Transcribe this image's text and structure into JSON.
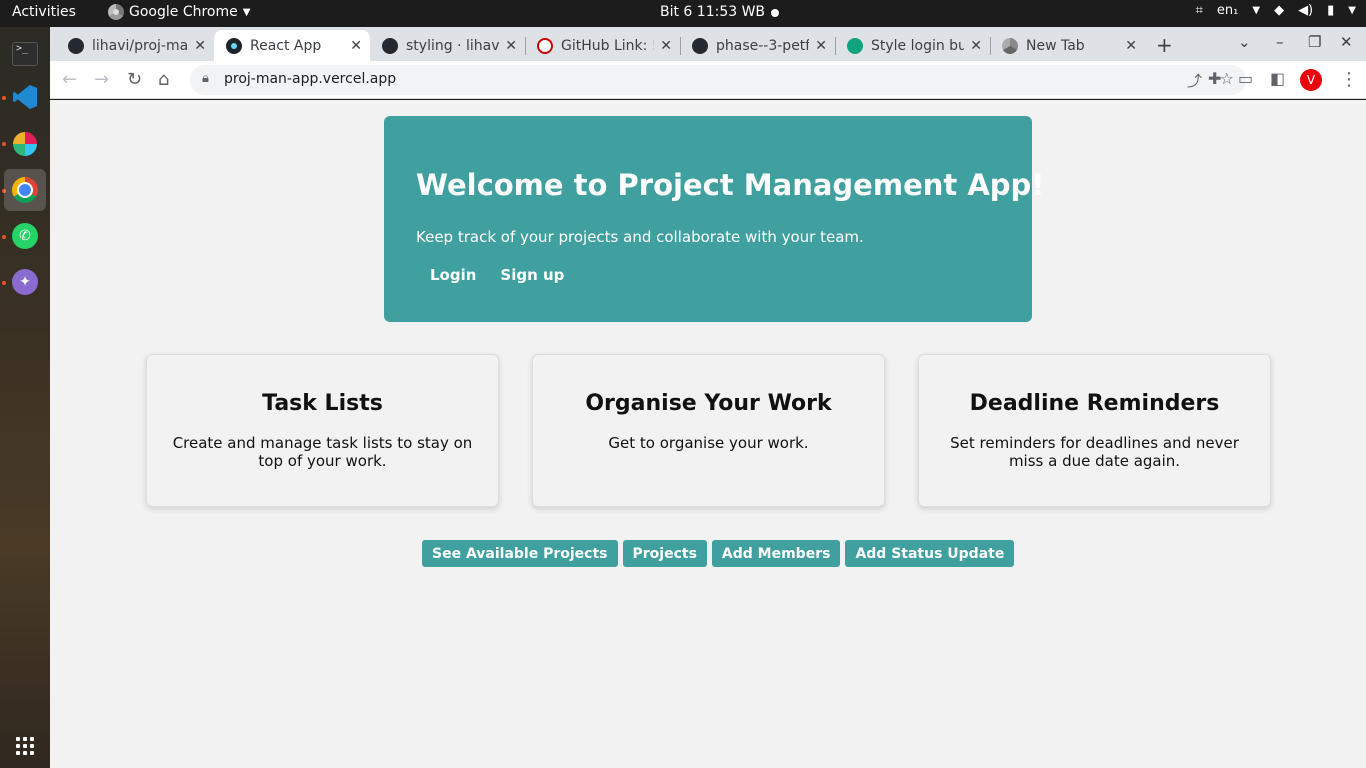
{
  "system_bar": {
    "activities": "Activities",
    "app_name": "Google Chrome",
    "clock": "Bit 6  11:53 WB",
    "language": "en₁"
  },
  "dock": {
    "items": [
      "terminal-icon",
      "vscode-icon",
      "slack-icon",
      "chrome-icon",
      "whatsapp-icon",
      "network-app-icon"
    ]
  },
  "tabs": [
    {
      "title": "lihavi/proj-ma",
      "favicon": "github-icon"
    },
    {
      "title": "React App",
      "favicon": "react-icon",
      "active": true
    },
    {
      "title": "styling · lihav",
      "favicon": "github-icon"
    },
    {
      "title": "GitHub Link: !",
      "favicon": "redhat-icon"
    },
    {
      "title": "phase--3-petf",
      "favicon": "github-icon"
    },
    {
      "title": "Style login bu",
      "favicon": "openai-icon"
    },
    {
      "title": "New Tab",
      "favicon": "chrome-icon"
    }
  ],
  "toolbar": {
    "url": "proj-man-app.vercel.app",
    "profile_initial": "V"
  },
  "hero": {
    "title": "Welcome to Project Management App!",
    "subtitle": "Keep track of your projects and collaborate with your team.",
    "login": "Login",
    "signup": "Sign up"
  },
  "features": [
    {
      "title": "Task Lists",
      "text": "Create and manage task lists to stay on top of your work."
    },
    {
      "title": "Organise Your Work",
      "text": "Get to organise your work."
    },
    {
      "title": "Deadline Reminders",
      "text": "Set reminders for deadlines and never miss a due date again."
    }
  ],
  "actions": {
    "available_projects": "See Available Projects",
    "projects": "Projects",
    "add_members": "Add Members",
    "add_status": "Add Status Update"
  },
  "colors": {
    "accent": "#40a0a0",
    "page_bg": "#f2f2f2"
  }
}
